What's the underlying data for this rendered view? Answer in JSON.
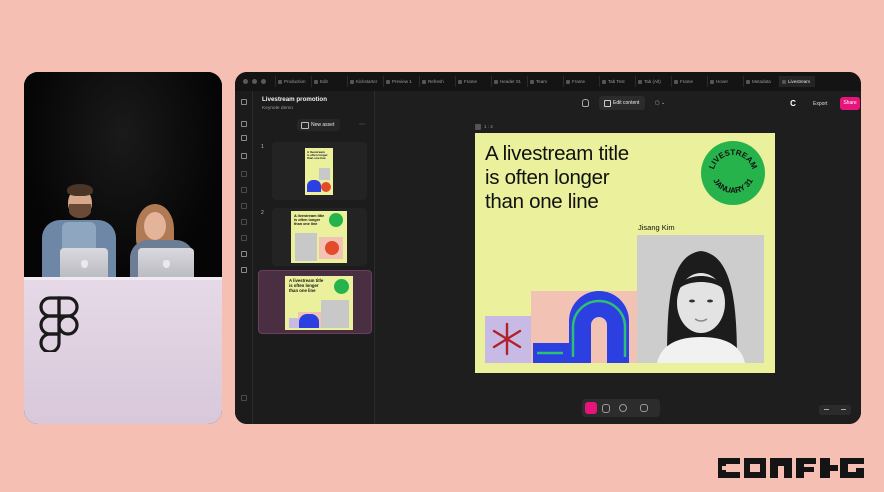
{
  "app": {
    "tabs": [
      "Production",
      "Edit",
      "Kickstarter",
      "Preview 1",
      "Refresh",
      "Frame",
      "Header 01",
      "Team",
      "Frame",
      "Tab Test",
      "Tab (Alt)",
      "Frame",
      "Hover",
      "Metadata",
      "Livestream",
      "Livestream"
    ],
    "active_tab": "Livestream"
  },
  "file": {
    "title": "Livestream promotion",
    "subtitle": "Keynote demo",
    "new_asset_label": "New asset",
    "rows": [
      "1",
      "2",
      "3"
    ]
  },
  "toolbar": {
    "edit_content_label": "Edit content",
    "export_label": "Export",
    "share_label": "Share",
    "c_label": "C"
  },
  "slide": {
    "frame_label": "1 : 4",
    "title": "A livestream title\nis often longer\nthan one line",
    "presenter": "Jisang Kim",
    "badge_top": "LIVESTREAM",
    "badge_bottom": "JANUARY 31",
    "thumb_title": "A livestream title is often longer than one line"
  },
  "colors": {
    "page_bg": "#f6bfb3",
    "slide_bg": "#eaf09b",
    "badge": "#26b34b",
    "share": "#e7157b",
    "blue_shape": "#2c3fe0"
  },
  "icons": [
    "figma-logo",
    "config-logo",
    "hand-icon",
    "edit-icon",
    "move-icon",
    "comment-icon"
  ]
}
